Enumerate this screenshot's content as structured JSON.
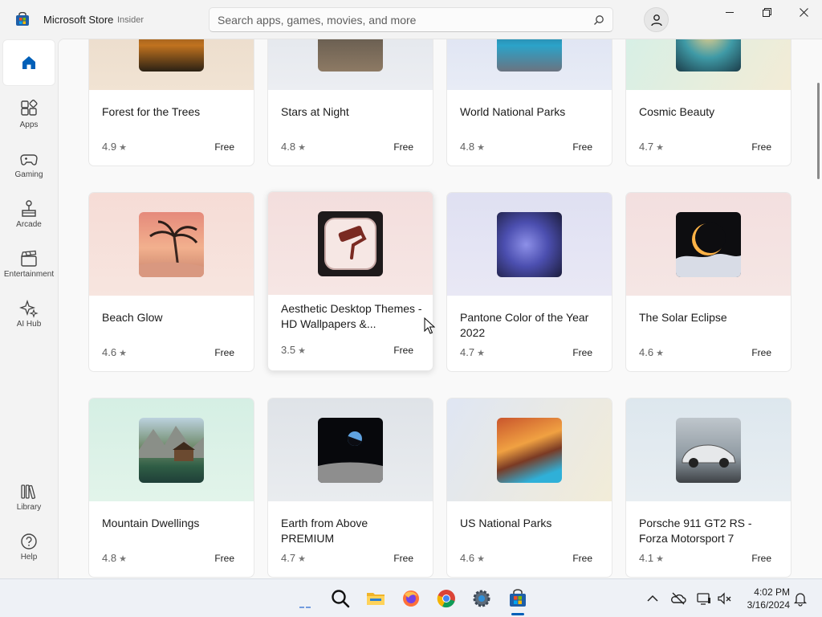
{
  "window": {
    "title": "Microsoft Store",
    "badge": "Insider"
  },
  "search": {
    "placeholder": "Search apps, games, movies, and more"
  },
  "sidebar": {
    "items": [
      {
        "label": "Home",
        "icon": "home-icon"
      },
      {
        "label": "Apps",
        "icon": "apps-icon"
      },
      {
        "label": "Gaming",
        "icon": "gaming-icon"
      },
      {
        "label": "Arcade",
        "icon": "arcade-icon"
      },
      {
        "label": "Entertainment",
        "icon": "entertainment-icon"
      },
      {
        "label": "AI Hub",
        "icon": "ai-hub-icon"
      },
      {
        "label": "Library",
        "icon": "library-icon"
      },
      {
        "label": "Help",
        "icon": "help-icon"
      }
    ]
  },
  "cards": [
    {
      "name": "Forest for the Trees",
      "rating": "4.9",
      "price": "Free"
    },
    {
      "name": "Stars at Night",
      "rating": "4.8",
      "price": "Free"
    },
    {
      "name": "World National Parks",
      "rating": "4.8",
      "price": "Free"
    },
    {
      "name": "Cosmic Beauty",
      "rating": "4.7",
      "price": "Free"
    },
    {
      "name": "Beach Glow",
      "rating": "4.6",
      "price": "Free"
    },
    {
      "name": "Aesthetic Desktop Themes - HD Wallpapers &...",
      "rating": "3.5",
      "price": "Free"
    },
    {
      "name": "Pantone Color of the Year 2022",
      "rating": "4.7",
      "price": "Free"
    },
    {
      "name": "The Solar Eclipse",
      "rating": "4.6",
      "price": "Free"
    },
    {
      "name": "Mountain Dwellings",
      "rating": "4.8",
      "price": "Free"
    },
    {
      "name": "Earth from Above PREMIUM",
      "rating": "4.7",
      "price": "Free"
    },
    {
      "name": "US National Parks",
      "rating": "4.6",
      "price": "Free"
    },
    {
      "name": "Porsche 911 GT2 RS - Forza Motorsport 7",
      "rating": "4.1",
      "price": "Free"
    }
  ],
  "taskbar": {
    "apps": [
      "widgets-icon",
      "search-icon",
      "file-explorer-icon",
      "firefox-icon",
      "chrome-icon",
      "settings-icon",
      "microsoft-store-icon"
    ],
    "time": "4:02 PM",
    "date": "3/16/2024"
  },
  "colors": {
    "accent": "#005fb8"
  }
}
